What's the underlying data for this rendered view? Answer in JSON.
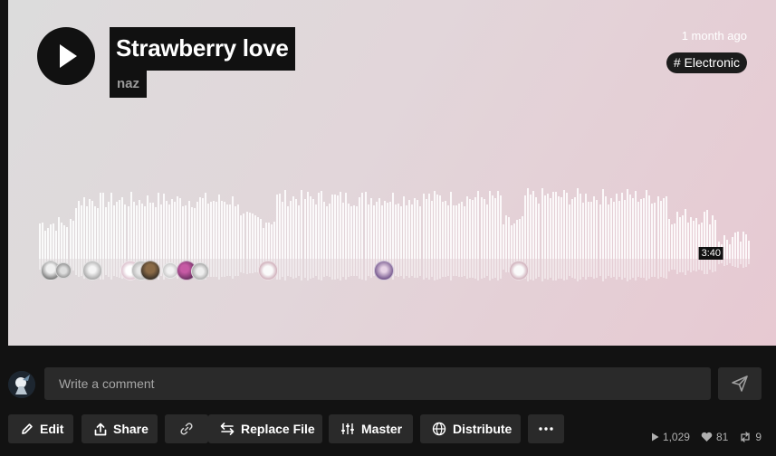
{
  "track": {
    "title": "Strawberry love",
    "artist": "naz",
    "posted": "1 month ago",
    "genre": "# Electronic",
    "duration": "3:40"
  },
  "icons": {
    "play": "play-icon",
    "send": "send-icon",
    "edit": "pencil-icon",
    "share": "share-icon",
    "link": "link-icon",
    "replace": "swap-arrows-icon",
    "master": "sliders-icon",
    "distribute": "globe-icon",
    "more": "more-dots-icon",
    "plays": "play-count-icon",
    "likes": "heart-icon",
    "reposts": "repost-icon"
  },
  "comment": {
    "placeholder": "Write a comment"
  },
  "actions": {
    "edit": "Edit",
    "share": "Share",
    "replace_file": "Replace File",
    "master": "Master",
    "distribute": "Distribute"
  },
  "stats": {
    "plays": "1,029",
    "likes": "81",
    "reposts": "9"
  },
  "colors": {
    "background": "#121212",
    "hero_start": "#dcdcdc",
    "hero_end": "#e7c9d2",
    "button": "#2a2a2a"
  }
}
